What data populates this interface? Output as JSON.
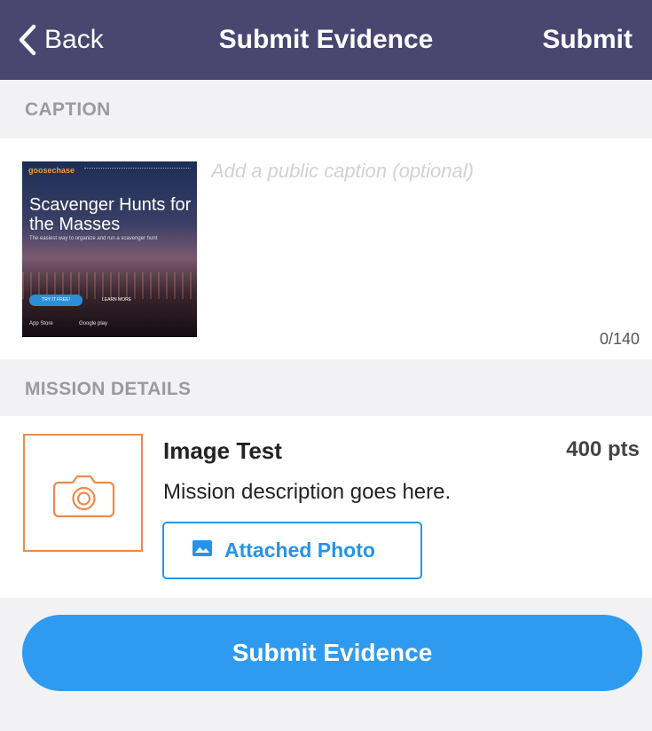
{
  "nav": {
    "back_label": "Back",
    "title": "Submit Evidence",
    "submit_label": "Submit",
    "back_icon": "chevron-left-icon",
    "background_color": "#4a4670"
  },
  "caption_section": {
    "header": "CAPTION",
    "placeholder": "Add a public caption (optional)",
    "value": "",
    "char_count": "0/140",
    "thumbnail": {
      "brand": "goosechase",
      "headline": "Scavenger Hunts for the Masses",
      "subline": "The easiest way to organize and run a scavenger hunt",
      "cta_primary": "TRY IT FREE!",
      "cta_secondary": "LEARN MORE",
      "store_1": "App Store",
      "store_2": "Google play"
    }
  },
  "mission_section": {
    "header": "MISSION DETAILS",
    "icon": "camera-icon",
    "icon_color": "#f0894a",
    "title": "Image Test",
    "points": "400 pts",
    "description": "Mission description goes here.",
    "attached_button": {
      "icon": "image-icon",
      "label": "Attached Photo"
    }
  },
  "footer": {
    "submit_button_label": "Submit Evidence",
    "accent_color": "#2f9bf0"
  }
}
